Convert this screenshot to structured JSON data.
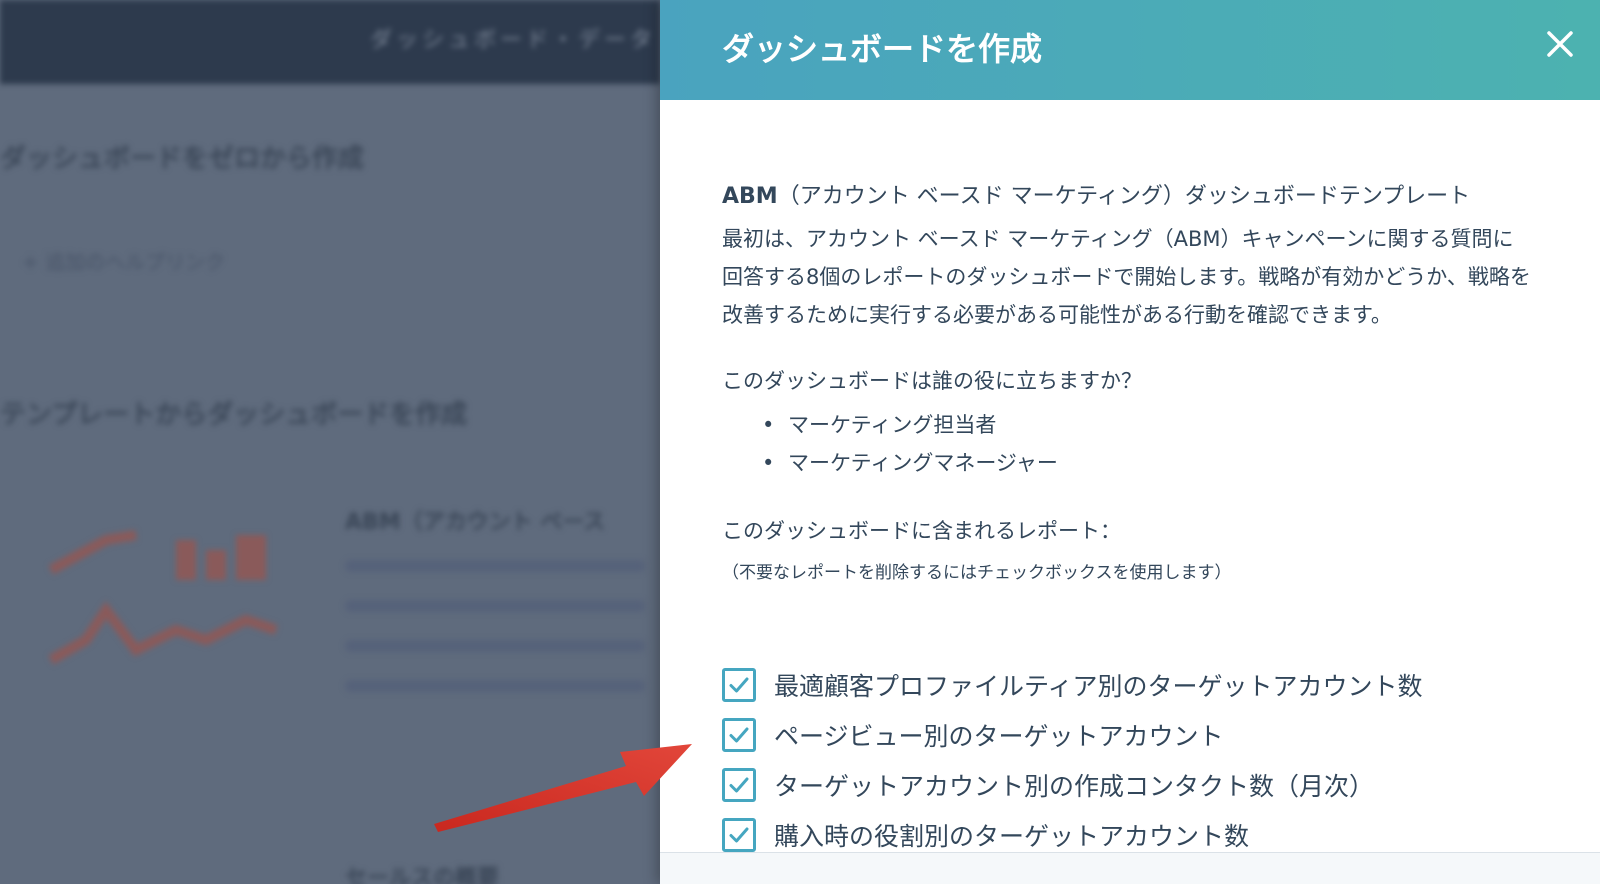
{
  "background": {
    "topbar_text": "ダッシュボード・データ",
    "title": "ダッシュボードをゼロから作成",
    "link": "+ 追加のヘルプリンク",
    "section_title": "テンプレートからダッシュボードを作成",
    "card_title": "ABM（アカウント ベース",
    "bottom_text": "セールスの概要"
  },
  "panel": {
    "title": "ダッシュボードを作成",
    "close_icon": "close-icon",
    "template_name_prefix": "ABM",
    "template_name_rest": "（アカウント ベースド マーケティング）ダッシュボードテンプレート",
    "description": "最初は、アカウント ベースド マーケティング（ABM）キャンペーンに関する質問に回答する8個のレポートのダッシュボードで開始します。戦略が有効かどうか、戦略を改善するために実行する必要がある可能性がある行動を確認できます。",
    "who_question": "このダッシュボードは誰の役に立ちますか？",
    "who_list": [
      "マーケティング担当者",
      "マーケティングマネージャー"
    ],
    "reports_heading": "このダッシュボードに含まれるレポート：",
    "reports_note": "（不要なレポートを削除するにはチェックボックスを使用します）",
    "reports": [
      {
        "label": "最適顧客プロファイルティア別のターゲットアカウント数",
        "checked": true
      },
      {
        "label": "ページビュー別のターゲットアカウント",
        "checked": true
      },
      {
        "label": "ターゲットアカウント別の作成コンタクト数（月次）",
        "checked": true
      },
      {
        "label": "購入時の役割別のターゲットアカウント数",
        "checked": true
      }
    ]
  },
  "colors": {
    "header_start": "#4aa3bf",
    "header_end": "#4cb2b0",
    "checkbox": "#45a6c0",
    "arrow": "#d9382c",
    "overlay": "#5f6b7d"
  }
}
